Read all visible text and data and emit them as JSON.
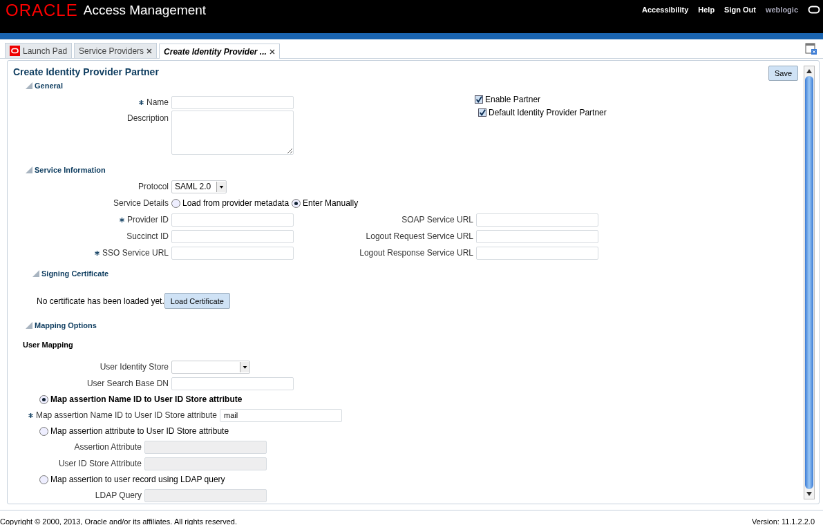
{
  "header": {
    "brand": "ORACLE",
    "product": "Access Management",
    "links": [
      "Accessibility",
      "Help",
      "Sign Out"
    ],
    "user": "weblogic"
  },
  "tabs": [
    {
      "label": "Launch Pad",
      "selected": false,
      "kind": "home"
    },
    {
      "label": "Service Providers",
      "selected": false,
      "kind": "closable"
    },
    {
      "label": "Create Identity Provider ...",
      "selected": true,
      "kind": "closable"
    }
  ],
  "page": {
    "title": "Create Identity Provider Partner",
    "save": "Save"
  },
  "general": {
    "title": "General",
    "fields": [
      {
        "label": "Name",
        "required": true,
        "kind": "text"
      },
      {
        "label": "Description",
        "required": false,
        "kind": "textarea"
      }
    ],
    "checkboxes": [
      {
        "label": "Enable Partner",
        "checked": true
      },
      {
        "label": "Default Identity Provider Partner",
        "checked": true
      }
    ]
  },
  "service": {
    "title": "Service Information",
    "protocol": {
      "label": "Protocol",
      "value": "SAML 2.0"
    },
    "details": {
      "label": "Service Details",
      "options": [
        {
          "label": "Load from provider metadata",
          "selected": false
        },
        {
          "label": "Enter Manually",
          "selected": true
        }
      ]
    },
    "left": [
      {
        "label": "Provider ID",
        "required": true
      },
      {
        "label": "Succinct ID",
        "required": false
      },
      {
        "label": "SSO Service URL",
        "required": true
      }
    ],
    "right": [
      {
        "label": "SOAP Service URL"
      },
      {
        "label": "Logout Request Service URL"
      },
      {
        "label": "Logout Response Service URL"
      }
    ]
  },
  "signing": {
    "title": "Signing Certificate",
    "message": "No certificate has been loaded yet.",
    "button": "Load Certificate"
  },
  "mapping": {
    "title": "Mapping Options",
    "subtitle": "User Mapping",
    "store": {
      "label": "User Identity Store"
    },
    "base_dn": {
      "label": "User Search Base DN"
    },
    "options": [
      {
        "label": "Map assertion Name ID to User ID Store attribute",
        "selected": true,
        "fields": [
          {
            "label": "Map assertion Name ID to User ID Store attribute",
            "required": true,
            "value": "mail",
            "disabled": false
          }
        ]
      },
      {
        "label": "Map assertion attribute to User ID Store attribute",
        "selected": false,
        "fields": [
          {
            "label": "Assertion Attribute",
            "required": false,
            "disabled": true
          },
          {
            "label": "User ID Store Attribute",
            "required": false,
            "disabled": true
          }
        ]
      },
      {
        "label": "Map assertion to user record using LDAP query",
        "selected": false,
        "fields": [
          {
            "label": "LDAP Query",
            "required": false,
            "disabled": true
          }
        ]
      }
    ]
  },
  "footer": {
    "copyright": "Copyright © 2000, 2013, Oracle and/or its affiliates. All rights reserved.",
    "version": "Version: 11.1.2.2.0"
  }
}
